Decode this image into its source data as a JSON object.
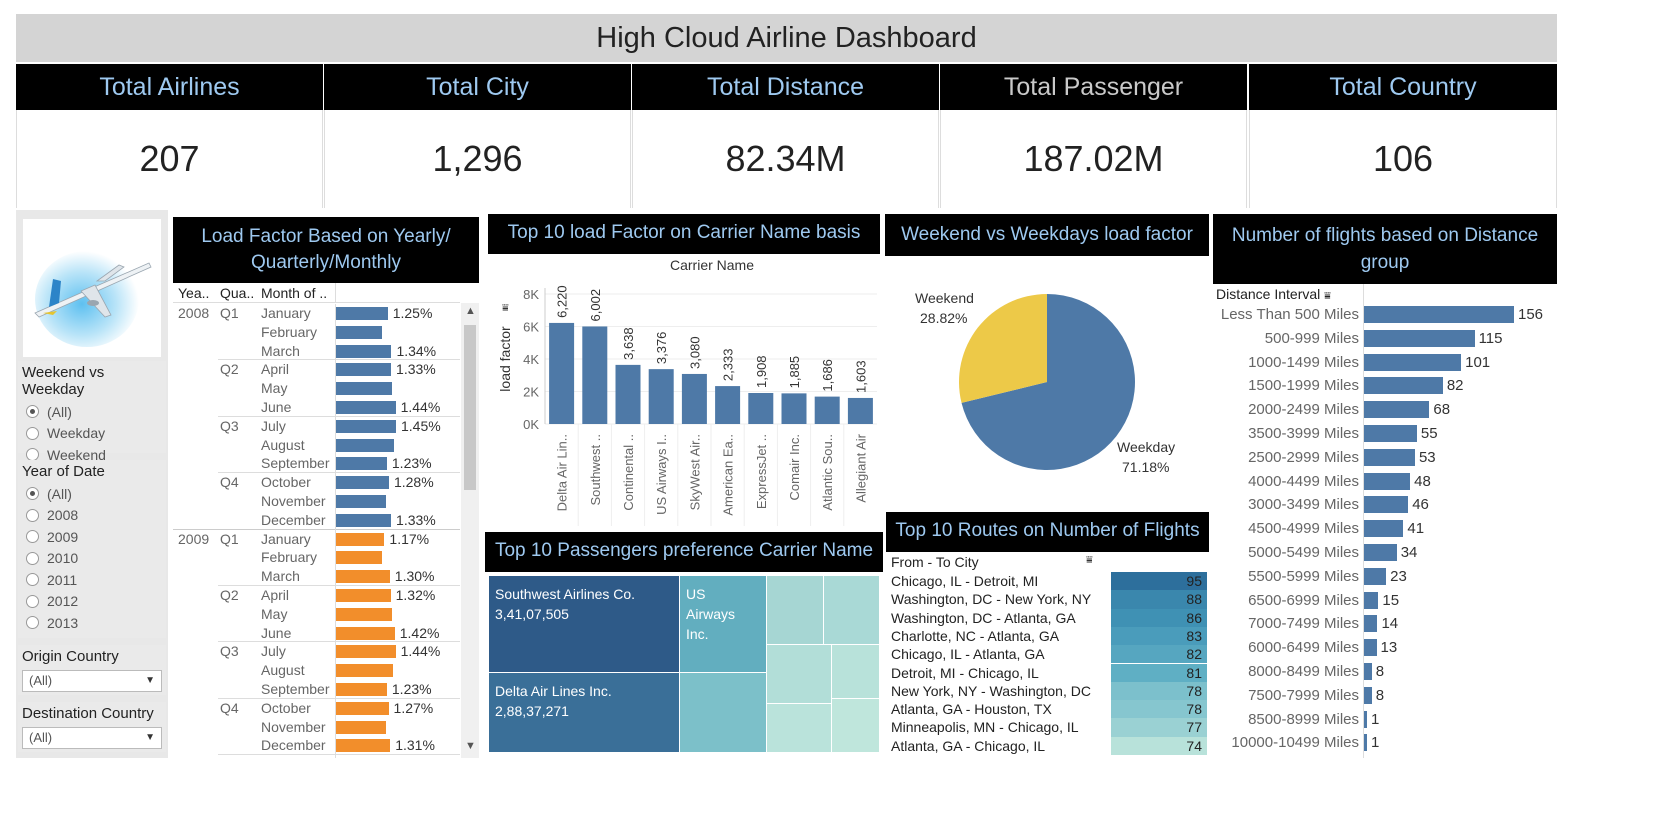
{
  "title": "High Cloud Airline Dashboard",
  "kpis": [
    {
      "label": "Total Airlines",
      "value": "207"
    },
    {
      "label": "Total City",
      "value": "1,296"
    },
    {
      "label": "Total Distance",
      "value": "82.34M"
    },
    {
      "label": "Total Passenger",
      "value": "187.02M"
    },
    {
      "label": "Total Country",
      "value": "106"
    }
  ],
  "filters": {
    "weekend": {
      "title": "Weekend vs Weekday",
      "options": [
        "(All)",
        "Weekday",
        "Weekend"
      ],
      "selected": "(All)"
    },
    "year": {
      "title": "Year of Date",
      "options": [
        "(All)",
        "2008",
        "2009",
        "2010",
        "2011",
        "2012",
        "2013"
      ],
      "selected": "(All)"
    },
    "origin": {
      "title": "Origin Country",
      "value": "(All)"
    },
    "destination": {
      "title": "Destination Country",
      "value": "(All)"
    }
  },
  "colors": {
    "blue": "#4e79a7",
    "orange": "#f28e2b",
    "yellow": "#edc948",
    "header_text": "#9ec9f0"
  },
  "chart_data": [
    {
      "type": "table",
      "title": "Load Factor Based on Yearly/ Quarterly/Monthly",
      "columns": [
        "Yea..",
        "Qua..",
        "Month of .."
      ],
      "rows": [
        {
          "year": "2008",
          "quarter": "Q1",
          "month": "January",
          "value": 1.25,
          "label": "1.25%"
        },
        {
          "year": "",
          "quarter": "",
          "month": "February",
          "value": 1.1,
          "label": ""
        },
        {
          "year": "",
          "quarter": "",
          "month": "March",
          "value": 1.34,
          "label": "1.34%"
        },
        {
          "year": "",
          "quarter": "Q2",
          "month": "April",
          "value": 1.33,
          "label": "1.33%"
        },
        {
          "year": "",
          "quarter": "",
          "month": "May",
          "value": 1.36,
          "label": ""
        },
        {
          "year": "",
          "quarter": "",
          "month": "June",
          "value": 1.44,
          "label": "1.44%"
        },
        {
          "year": "",
          "quarter": "Q3",
          "month": "July",
          "value": 1.45,
          "label": "1.45%"
        },
        {
          "year": "",
          "quarter": "",
          "month": "August",
          "value": 1.4,
          "label": ""
        },
        {
          "year": "",
          "quarter": "",
          "month": "September",
          "value": 1.23,
          "label": "1.23%"
        },
        {
          "year": "",
          "quarter": "Q4",
          "month": "October",
          "value": 1.28,
          "label": "1.28%"
        },
        {
          "year": "",
          "quarter": "",
          "month": "November",
          "value": 1.2,
          "label": ""
        },
        {
          "year": "",
          "quarter": "",
          "month": "December",
          "value": 1.33,
          "label": "1.33%"
        },
        {
          "year": "2009",
          "quarter": "Q1",
          "month": "January",
          "value": 1.17,
          "label": "1.17%"
        },
        {
          "year": "",
          "quarter": "",
          "month": "February",
          "value": 1.1,
          "label": ""
        },
        {
          "year": "",
          "quarter": "",
          "month": "March",
          "value": 1.3,
          "label": "1.30%"
        },
        {
          "year": "",
          "quarter": "Q2",
          "month": "April",
          "value": 1.32,
          "label": "1.32%"
        },
        {
          "year": "",
          "quarter": "",
          "month": "May",
          "value": 1.35,
          "label": ""
        },
        {
          "year": "",
          "quarter": "",
          "month": "June",
          "value": 1.42,
          "label": "1.42%"
        },
        {
          "year": "",
          "quarter": "Q3",
          "month": "July",
          "value": 1.44,
          "label": "1.44%"
        },
        {
          "year": "",
          "quarter": "",
          "month": "August",
          "value": 1.38,
          "label": ""
        },
        {
          "year": "",
          "quarter": "",
          "month": "September",
          "value": 1.23,
          "label": "1.23%"
        },
        {
          "year": "",
          "quarter": "Q4",
          "month": "October",
          "value": 1.27,
          "label": "1.27%"
        },
        {
          "year": "",
          "quarter": "",
          "month": "November",
          "value": 1.2,
          "label": ""
        },
        {
          "year": "",
          "quarter": "",
          "month": "December",
          "value": 1.31,
          "label": "1.31%"
        }
      ]
    },
    {
      "type": "bar",
      "title": "Top 10 load Factor on Carrier Name basis",
      "xlabel": "Carrier Name",
      "ylabel": "load factor",
      "ylim": [
        0,
        8000
      ],
      "yticks": [
        "0K",
        "2K",
        "4K",
        "6K",
        "8K"
      ],
      "categories": [
        "Delta Air Lin..",
        "Southwest ..",
        "Continental ..",
        "US Airways I..",
        "SkyWest Air..",
        "American Ea..",
        "ExpressJet ..",
        "Comair Inc.",
        "Atlantic Sou..",
        "Allegiant Air"
      ],
      "values": [
        6220,
        6002,
        3638,
        3376,
        3080,
        2333,
        1908,
        1885,
        1686,
        1603
      ],
      "labels": [
        "6,220",
        "6,002",
        "3,638",
        "3,376",
        "3,080",
        "2,333",
        "1,908",
        "1,885",
        "1,686",
        "1,603"
      ]
    },
    {
      "type": "pie",
      "title": "Weekend vs Weekdays load factor",
      "slices": [
        {
          "name": "Weekend",
          "value": 28.82,
          "label": "28.82%",
          "color": "#edc948"
        },
        {
          "name": "Weekday",
          "value": 71.18,
          "label": "71.18%",
          "color": "#4e79a7"
        }
      ]
    },
    {
      "type": "bar",
      "title": "Number of flights based on Distance group",
      "header": "Distance Interval",
      "categories": [
        "Less Than 500 Miles",
        "500-999 Miles",
        "1000-1499 Miles",
        "1500-1999 Miles",
        "2000-2499 Miles",
        "3500-3999 Miles",
        "2500-2999 Miles",
        "4000-4499 Miles",
        "3000-3499 Miles",
        "4500-4999 Miles",
        "5000-5499 Miles",
        "5500-5999 Miles",
        "6500-6999 Miles",
        "7000-7499 Miles",
        "6000-6499 Miles",
        "8000-8499 Miles",
        "7500-7999 Miles",
        "8500-8999 Miles",
        "10000-10499 Miles"
      ],
      "values": [
        156,
        115,
        101,
        82,
        68,
        55,
        53,
        48,
        46,
        41,
        34,
        23,
        15,
        14,
        13,
        8,
        8,
        1,
        1
      ]
    },
    {
      "type": "table",
      "title": "Top 10 Routes on Number of Flights",
      "header": "From - To City",
      "rows": [
        {
          "route": "Chicago, IL - Detroit, MI",
          "value": 95
        },
        {
          "route": "Washington, DC - New York, NY",
          "value": 88
        },
        {
          "route": "Washington, DC - Atlanta, GA",
          "value": 86
        },
        {
          "route": "Charlotte, NC - Atlanta, GA",
          "value": 83
        },
        {
          "route": "Chicago, IL - Atlanta, GA",
          "value": 82
        },
        {
          "route": "Detroit, MI - Chicago, IL",
          "value": 81
        },
        {
          "route": "New York, NY - Washington, DC",
          "value": 78
        },
        {
          "route": "Atlanta, GA - Houston, TX",
          "value": 78
        },
        {
          "route": "Minneapolis, MN - Chicago, IL",
          "value": 77
        },
        {
          "route": "Atlanta, GA - Chicago, IL",
          "value": 74
        }
      ]
    },
    {
      "type": "treemap",
      "title": "Top 10 Passengers preference Carrier Name",
      "items": [
        {
          "name": "Southwest Airlines Co.",
          "label": "3,41,07,505",
          "value": 34107505
        },
        {
          "name": "Delta Air Lines Inc.",
          "label": "2,88,37,271",
          "value": 28837271
        },
        {
          "name": "US Airways Inc.",
          "label": ""
        }
      ]
    }
  ]
}
